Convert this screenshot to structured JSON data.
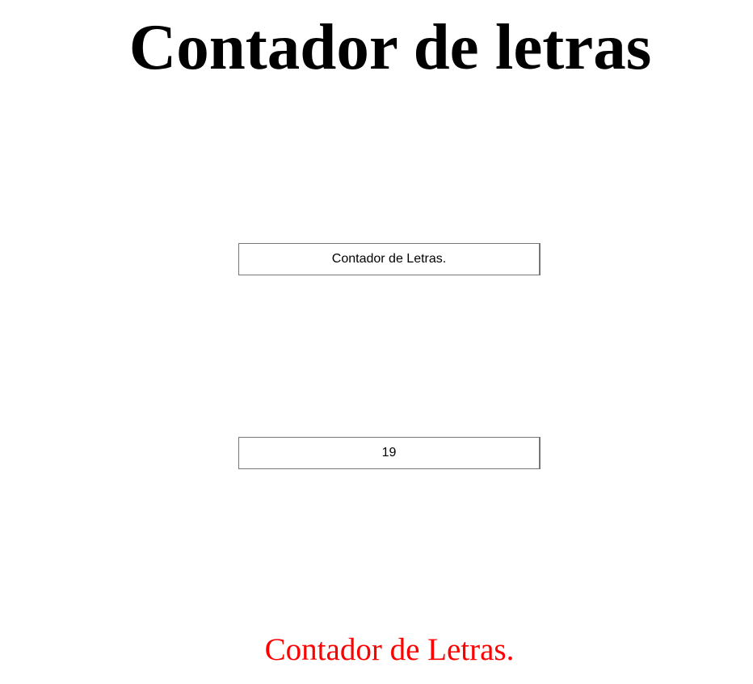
{
  "page": {
    "title": "Contador de letras"
  },
  "text_input": {
    "value": "Contador de Letras."
  },
  "count_output": {
    "value": "19"
  },
  "echo": {
    "text": "Contador de Letras.",
    "color": "#ff0000"
  }
}
